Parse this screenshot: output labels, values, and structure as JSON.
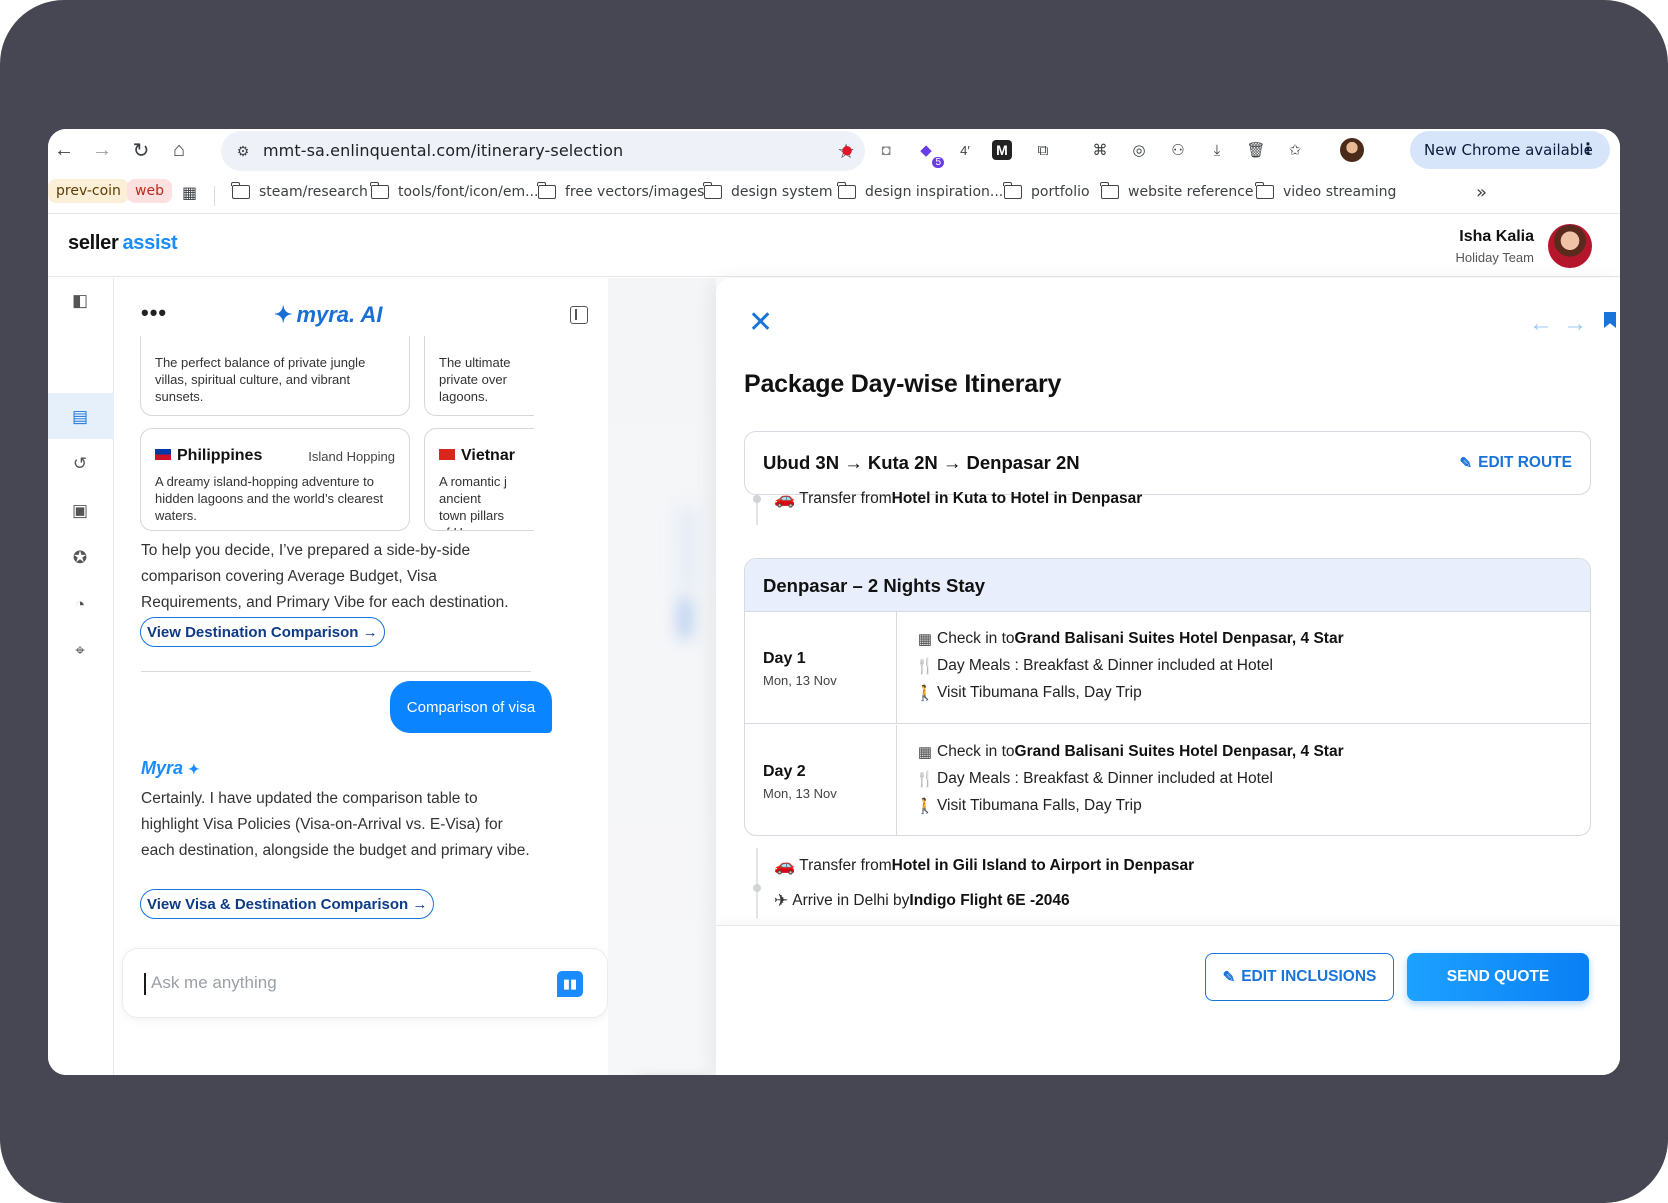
{
  "browser": {
    "url": "mmt-sa.enlinquental.com/itinerary-selection",
    "ext_badge": "5",
    "ext_timer": "4′",
    "new_chrome": "New Chrome available",
    "bookmarks": {
      "chip1": "prev-coin",
      "chip2": "web",
      "items": [
        "steam/research",
        "tools/font/icon/em...",
        "free vectors/images",
        "design system",
        "design inspiration...",
        "portfolio",
        "website reference",
        "video streaming"
      ],
      "overflow": "»"
    }
  },
  "app": {
    "brand_main": "seller",
    "brand_accent": "assist",
    "user_name": "Isha Kalia",
    "user_team": "Holiday Team"
  },
  "chat": {
    "menu": "•••",
    "logo": "myra. AI",
    "cards": [
      {
        "title": "",
        "tag": "",
        "desc": "The perfect balance of private jungle villas, spiritual culture, and vibrant sunsets."
      },
      {
        "title": "",
        "tag": "",
        "desc": "The ultimate private over lagoons."
      },
      {
        "title": "Philippines",
        "tag": "Island Hopping",
        "desc": "A dreamy island-hopping adventure to hidden lagoons and the world’s clearest waters."
      },
      {
        "title": "Vietnar",
        "tag": "",
        "desc": "A romantic j ancient town pillars of Ha"
      }
    ],
    "intro": "To help you decide, I’ve prepared a side-by-side comparison covering Average Budget, Visa Requirements, and Primary Vibe for each destination.",
    "link1": "View Destination Comparison →",
    "user_message": "Comparison of visa",
    "assistant_name": "Myra",
    "reply": "Certainly. I have updated the comparison table to highlight Visa Policies (Visa-on-Arrival vs. E-Visa) for each destination, alongside the budget and primary vibe.",
    "link2": "View Visa & Destination Comparison →",
    "input_placeholder": "Ask me anything"
  },
  "itinerary": {
    "title": "Package Day-wise Itinerary",
    "route": "Ubud 3N → Kuta 2N → Denpasar 2N",
    "edit_route": "EDIT ROUTE",
    "transfer1_prefix": "Transfer from ",
    "transfer1_bold": "Hotel in Kuta to Hotel in Denpasar",
    "stay_title": "Denpasar – 2 Nights Stay",
    "days": [
      {
        "label": "Day 1",
        "date": "Mon, 13 Nov",
        "checkin_prefix": "Check in to ",
        "checkin_bold": "Grand Balisani Suites Hotel Denpasar, 4 Star",
        "meals": "Day Meals : Breakfast & Dinner included at Hotel",
        "visit": "Visit Tibumana Falls, Day Trip"
      },
      {
        "label": "Day 2",
        "date": "Mon, 13 Nov",
        "checkin_prefix": "Check in to ",
        "checkin_bold": "Grand Balisani Suites Hotel Denpasar, 4 Star",
        "meals": "Day Meals : Breakfast & Dinner included at Hotel",
        "visit": "Visit Tibumana Falls, Day Trip"
      }
    ],
    "transfer2_prefix": "Transfer from ",
    "transfer2_bold": "Hotel in Gili Island to Airport in Denpasar",
    "arrive_prefix": "Arrive in Delhi by ",
    "arrive_bold": "Indigo Flight 6E -2046",
    "edit_inclusions": "EDIT INCLUSIONS",
    "send_quote": "SEND QUOTE"
  },
  "colors": {
    "accent": "#1a8cff",
    "primary_blue": "#1a73d9",
    "stay_header_bg": "#e8eefc",
    "user_bubble": "#0a84ff"
  }
}
